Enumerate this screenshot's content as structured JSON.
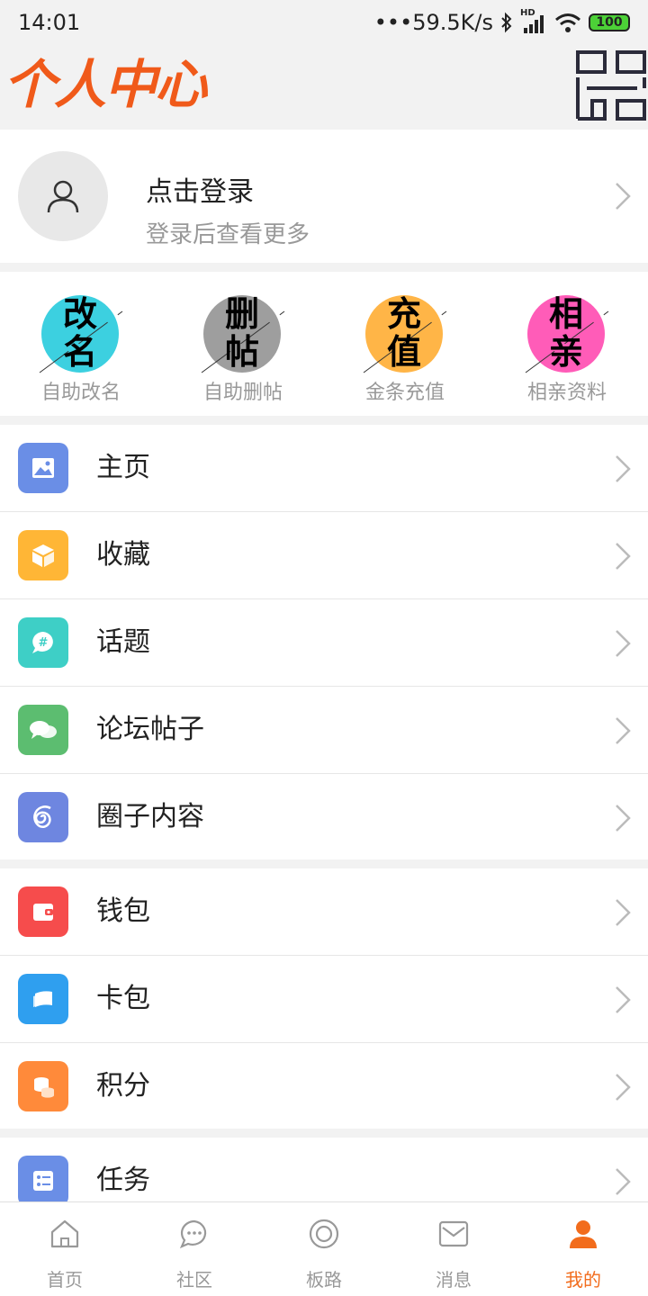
{
  "status_bar": {
    "time": "14:01",
    "network_speed": "•••59.5K/s",
    "hd_label": "HD",
    "battery": "100"
  },
  "header": {
    "title": "个人中心",
    "scan_icon": "qr-scan-icon"
  },
  "profile": {
    "title": "点击登录",
    "subtitle": "登录后查看更多",
    "avatar_icon": "user-icon"
  },
  "quick_actions": [
    {
      "glyph_top": "改",
      "glyph_bottom": "名",
      "label": "自助改名",
      "color": "#3cd0e0"
    },
    {
      "glyph_top": "删",
      "glyph_bottom": "帖",
      "label": "自助删帖",
      "color": "#9e9e9e"
    },
    {
      "glyph_top": "充",
      "glyph_bottom": "值",
      "label": "金条充值",
      "color": "#ffb547"
    },
    {
      "glyph_top": "相",
      "glyph_bottom": "亲",
      "label": "相亲资料",
      "color": "#ff5cb8"
    }
  ],
  "menu_group_1": [
    {
      "label": "主页",
      "icon": "image-icon",
      "color": "#6a8ee6"
    },
    {
      "label": "收藏",
      "icon": "box-icon",
      "color": "#ffb636"
    },
    {
      "label": "话题",
      "icon": "hashtag-chat-icon",
      "color": "#3ecfc6"
    },
    {
      "label": "论坛帖子",
      "icon": "chat-bubbles-icon",
      "color": "#5cbd70"
    },
    {
      "label": "圈子内容",
      "icon": "spiral-icon",
      "color": "#6e86e0"
    }
  ],
  "menu_group_2": [
    {
      "label": "钱包",
      "icon": "wallet-icon",
      "color": "#f64c4c"
    },
    {
      "label": "卡包",
      "icon": "card-icon",
      "color": "#2f9fef"
    },
    {
      "label": "积分",
      "icon": "coins-icon",
      "color": "#ff8a3a"
    }
  ],
  "menu_group_3": [
    {
      "label": "任务",
      "icon": "checklist-icon",
      "color": "#6a8ee6"
    }
  ],
  "tabbar": [
    {
      "label": "首页",
      "icon": "home-icon"
    },
    {
      "label": "社区",
      "icon": "chat-icon"
    },
    {
      "label": "板路",
      "icon": "circle-target-icon"
    },
    {
      "label": "消息",
      "icon": "mail-icon"
    },
    {
      "label": "我的",
      "icon": "person-icon",
      "active_color": "#f26c1c"
    }
  ]
}
